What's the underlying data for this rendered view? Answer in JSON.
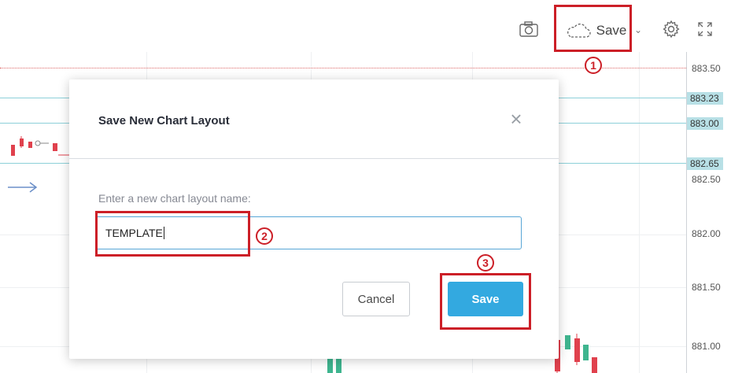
{
  "toolbar": {
    "camera_icon": "camera-icon",
    "save_label": "Save",
    "caret": "⌄",
    "gear_icon": "gear-icon",
    "fullscreen_icon": "fullscreen-icon"
  },
  "price_axis": {
    "ticks": [
      "883.50",
      "882.50",
      "882.00",
      "881.50",
      "881.00"
    ],
    "level_labels": [
      "883.23",
      "883.00",
      "882.65"
    ]
  },
  "dialog": {
    "title": "Save New Chart Layout",
    "close": "×",
    "label": "Enter a new chart layout name:",
    "input_value": "TEMPLATE",
    "cancel_label": "Cancel",
    "save_label": "Save"
  },
  "annotations": {
    "step1": "1",
    "step2": "2",
    "step3": "3",
    "color": "#cc1f27"
  },
  "colors": {
    "accent": "#33a9e0",
    "level_line": "#8dd0d9",
    "candle_red": "#e0414d",
    "candle_green": "#3fb58f"
  }
}
